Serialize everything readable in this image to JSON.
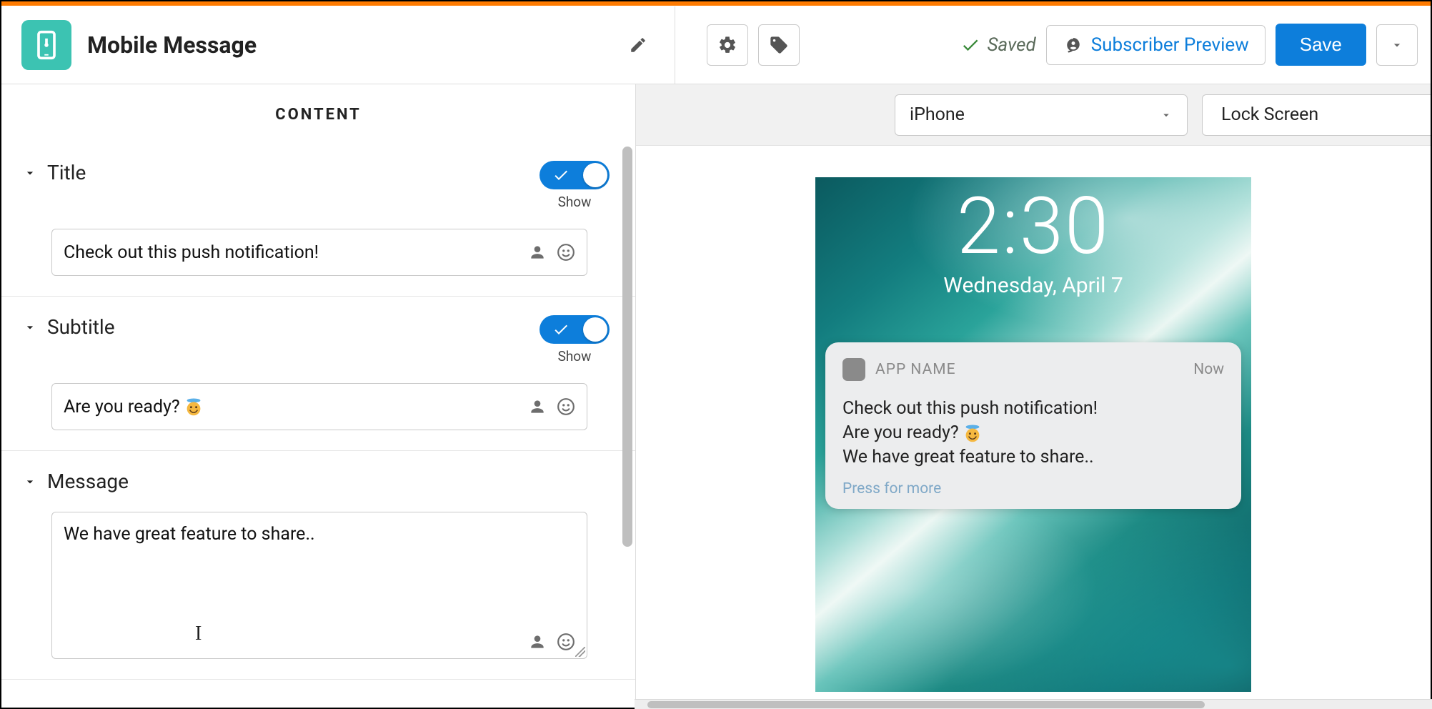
{
  "header": {
    "title": "Mobile Message",
    "saved_label": "Saved",
    "subscriber_preview_label": "Subscriber Preview",
    "save_label": "Save"
  },
  "content": {
    "tab_label": "CONTENT",
    "sections": {
      "title": {
        "label": "Title",
        "toggle_label": "Show",
        "value": "Check out this push notification!"
      },
      "subtitle": {
        "label": "Subtitle",
        "toggle_label": "Show",
        "value": "Are you ready?"
      },
      "message": {
        "label": "Message",
        "value": "We have great feature to share.."
      }
    }
  },
  "preview": {
    "device": "iPhone",
    "view": "Lock Screen",
    "lock": {
      "time": "2:30",
      "date": "Wednesday, April 7"
    },
    "notification": {
      "app_name": "APP NAME",
      "time": "Now",
      "title": "Check out this push notification!",
      "subtitle": "Are you ready?",
      "message": "We have great feature to share..",
      "more": "Press for more"
    }
  }
}
